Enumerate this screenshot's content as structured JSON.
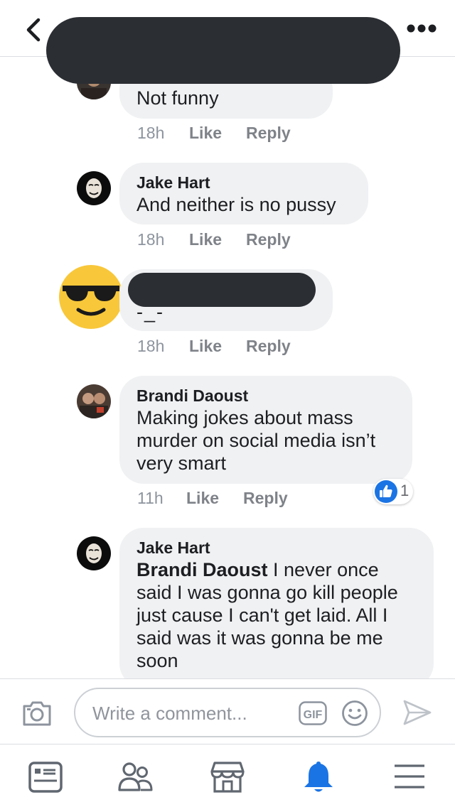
{
  "header": {
    "back_icon": "chevron-left-icon",
    "more_icon": "more-dots-icon"
  },
  "comments": [
    {
      "author": "",
      "text": "Not funny",
      "time": "18h",
      "like_label": "Like",
      "reply_label": "Reply"
    },
    {
      "author": "Jake Hart",
      "text": "And neither is no pussy",
      "time": "18h",
      "like_label": "Like",
      "reply_label": "Reply"
    },
    {
      "author": "",
      "text": "-_-",
      "time": "18h",
      "like_label": "Like",
      "reply_label": "Reply"
    },
    {
      "author": "Brandi Daoust",
      "text_lines": [
        "Making jokes about mass",
        "murder on social media isn’t",
        "very smart"
      ],
      "time": "11h",
      "like_label": "Like",
      "reply_label": "Reply",
      "reaction_count": "1"
    },
    {
      "author": "Jake Hart",
      "mention": "Brandi Daoust",
      "text_lines": [
        " I never once",
        "said I was gonna go kill people",
        "just cause I can't get laid. All I",
        "said was it was gonna be me",
        "soon"
      ]
    }
  ],
  "composer": {
    "placeholder": "Write a comment...",
    "gif_label": "GIF"
  },
  "tabbar": {
    "items": [
      "news-feed-icon",
      "friends-icon",
      "marketplace-icon",
      "notifications-bell-icon",
      "menu-icon"
    ],
    "active_index": 3
  },
  "colors": {
    "accent": "#1b74e4",
    "bubble": "#f0f1f3",
    "meta": "#7f8389",
    "redaction": "#2b2e33"
  }
}
